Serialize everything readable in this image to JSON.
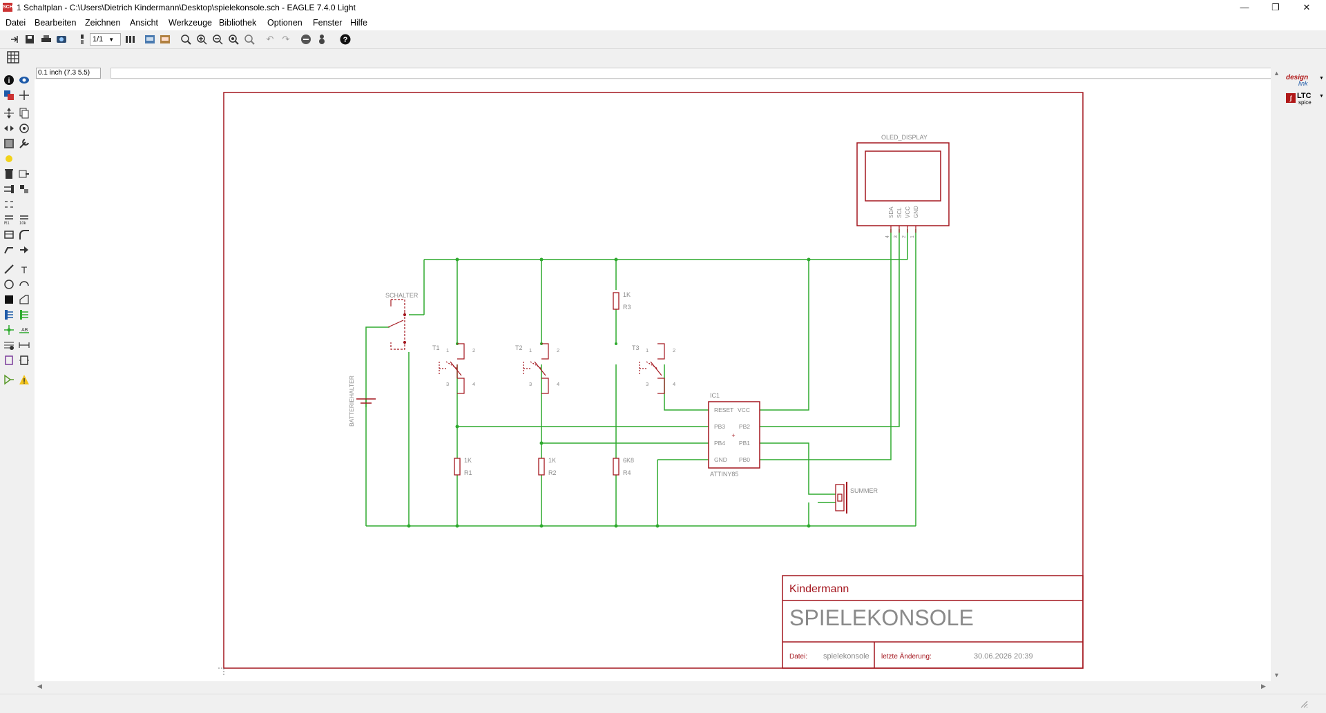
{
  "window": {
    "title": "1 Schaltplan - C:\\Users\\Dietrich Kindermann\\Desktop\\spielekonsole.sch - EAGLE 7.4.0 Light",
    "app_icon_text": "SCH",
    "minimize": "—",
    "maximize": "❐",
    "close": "✕"
  },
  "menu": [
    "Datei",
    "Bearbeiten",
    "Zeichnen",
    "Ansicht",
    "Werkzeuge",
    "Bibliothek",
    "Optionen",
    "Fenster",
    "Hilfe"
  ],
  "toolbar": {
    "sheet_select": "1/1"
  },
  "coord": {
    "readout": "0.1 inch (7.3 5.5)"
  },
  "right_panel": {
    "designlink_top": "design",
    "designlink_bottom": "link",
    "ltc_top": "LTC",
    "ltc_bottom": "spice"
  },
  "schematic": {
    "display_label": "OLED_DISPLAY",
    "display_pins": [
      "SDA",
      "SCL",
      "VCC",
      "GND"
    ],
    "display_pin_numbers": [
      "4",
      "3",
      "2",
      "1"
    ],
    "switch_label": "SCHALTER",
    "battery_label": "BATTERIEHALTER",
    "buttons": [
      "T1",
      "T2",
      "T3"
    ],
    "button_pins": [
      "1",
      "2",
      "3",
      "4"
    ],
    "r1_value": "1K",
    "r1_name": "R1",
    "r2_value": "1K",
    "r2_name": "R2",
    "r3_value": "1K",
    "r3_name": "R3",
    "r4_value": "6K8",
    "r4_name": "R4",
    "ic_name": "IC1",
    "ic_value": "ATTINY85",
    "ic_pins_left": [
      "RESET",
      "PB3",
      "PB4",
      "GND"
    ],
    "ic_pins_right": [
      "VCC",
      "PB2",
      "PB1",
      "PB0"
    ],
    "buzzer_label": "SUMMER"
  },
  "titleblock": {
    "company": "Kindermann",
    "title": "SPIELEKONSOLE",
    "file_label": "Datei:",
    "file_value": "spielekonsole",
    "changed_label": "letzte Änderung:",
    "changed_value": "30.06.2026 20:39"
  },
  "colors": {
    "frame": "#a4161e",
    "net": "#2eaa2e",
    "symbol": "#a4161e",
    "label": "#8a8a8a"
  }
}
